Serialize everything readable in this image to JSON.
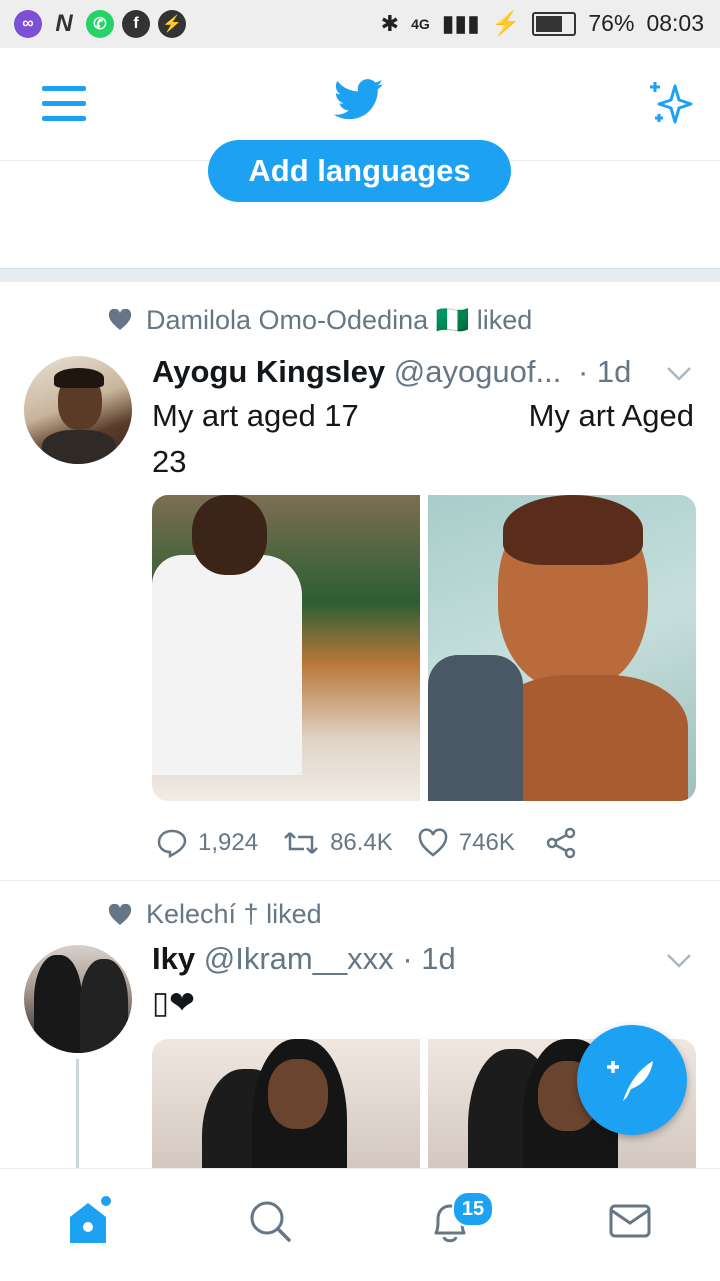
{
  "status_bar": {
    "left_icons": [
      "link-app-icon",
      "n-app-icon",
      "whatsapp-icon",
      "facebook-icon",
      "messenger-icon"
    ],
    "n_label": "N",
    "network_label": "4G",
    "battery_percent": 76,
    "battery": "76%",
    "time": "08:03"
  },
  "header": {
    "menu_icon": "hamburger-icon",
    "logo_icon": "twitter-bird-icon",
    "sparkle_icon": "sparkle-icon"
  },
  "prompt": {
    "add_languages_label": "Add languages"
  },
  "tweets": [
    {
      "social_context": "Damilola Omo-Odedina 🇳🇬 liked",
      "author_name": "Ayogu Kingsley",
      "handle": "@ayoguof...",
      "time": "· 1d",
      "text_left": "My art aged 17",
      "text_right": "My art Aged",
      "text_line2": "23",
      "replies": "1,924",
      "retweets": "86.4K",
      "likes": "746K"
    },
    {
      "social_context": "Kelechí † liked",
      "author_name": "Iky",
      "handle": "@Ikram__xxx",
      "time": "· 1d",
      "text": "▯❤"
    }
  ],
  "nav": {
    "notifications_badge": "15"
  },
  "colors": {
    "accent": "#1da1f2",
    "secondary_text": "#657786",
    "primary_text": "#14171a"
  }
}
